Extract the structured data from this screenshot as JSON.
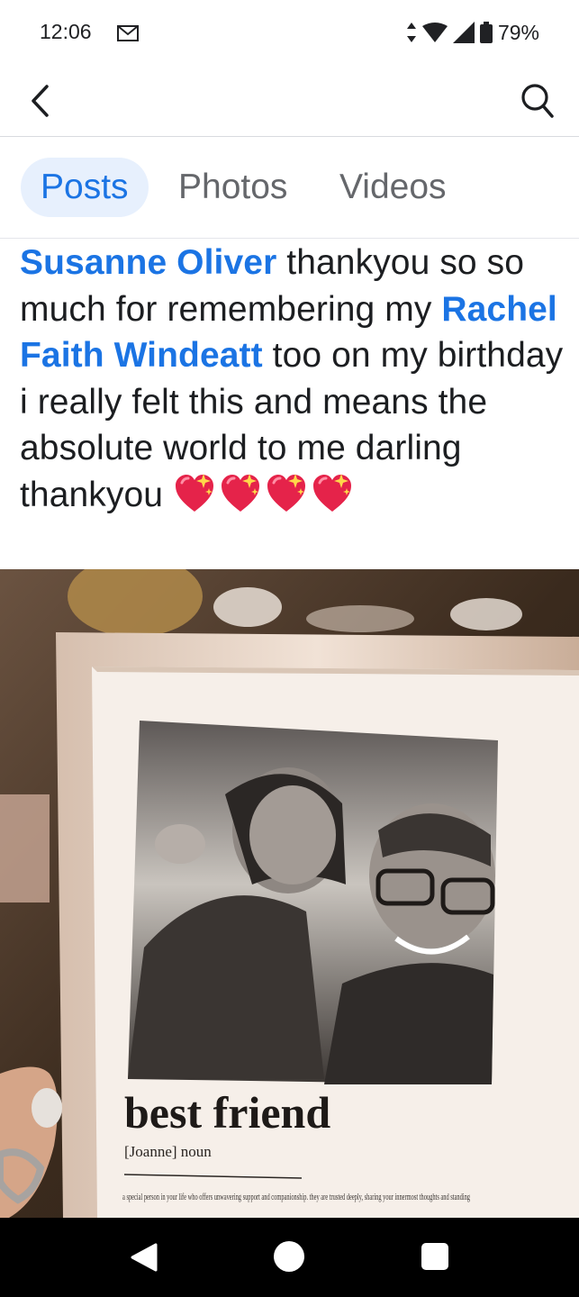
{
  "status_bar": {
    "time": "12:06",
    "battery": "79%",
    "icons": [
      "mail-icon",
      "data-arrows-icon",
      "wifi-icon",
      "signal-icon",
      "battery-icon"
    ]
  },
  "header": {
    "back_icon": "back-arrow-icon",
    "search_icon": "search-icon"
  },
  "tabs": [
    {
      "label": "Posts",
      "active": true
    },
    {
      "label": "Photos",
      "active": false
    },
    {
      "label": "Videos",
      "active": false
    }
  ],
  "post": {
    "mention_1": "Susanne Oliver",
    "text_1": " thankyou so so much for remembering my ",
    "mention_2": "Rachel Faith Windeatt",
    "text_2": " too on my birthday i really felt this and means the absolute world to me darling thankyou ",
    "emoji": "sparkling-heart-icon",
    "emoji_count": 4
  },
  "photo": {
    "frame_title": "best friend",
    "frame_subtitle": "[Joanne] noun",
    "frame_definition": "a special person in your life who offers unwavering support and companionship. they are trusted deeply, sharing your innermost thoughts and standing",
    "colors": {
      "frame": "#e9d7c9",
      "mat": "#f6efe9",
      "backdrop": "#3a2a1d"
    }
  },
  "nav_bar": {
    "icons": [
      "nav-back-icon",
      "nav-home-icon",
      "nav-recents-icon"
    ]
  },
  "colors": {
    "accent": "#1b74e4",
    "tab_active_bg": "#e7f0fd",
    "text": "#1c1e21",
    "muted": "#65676b"
  }
}
